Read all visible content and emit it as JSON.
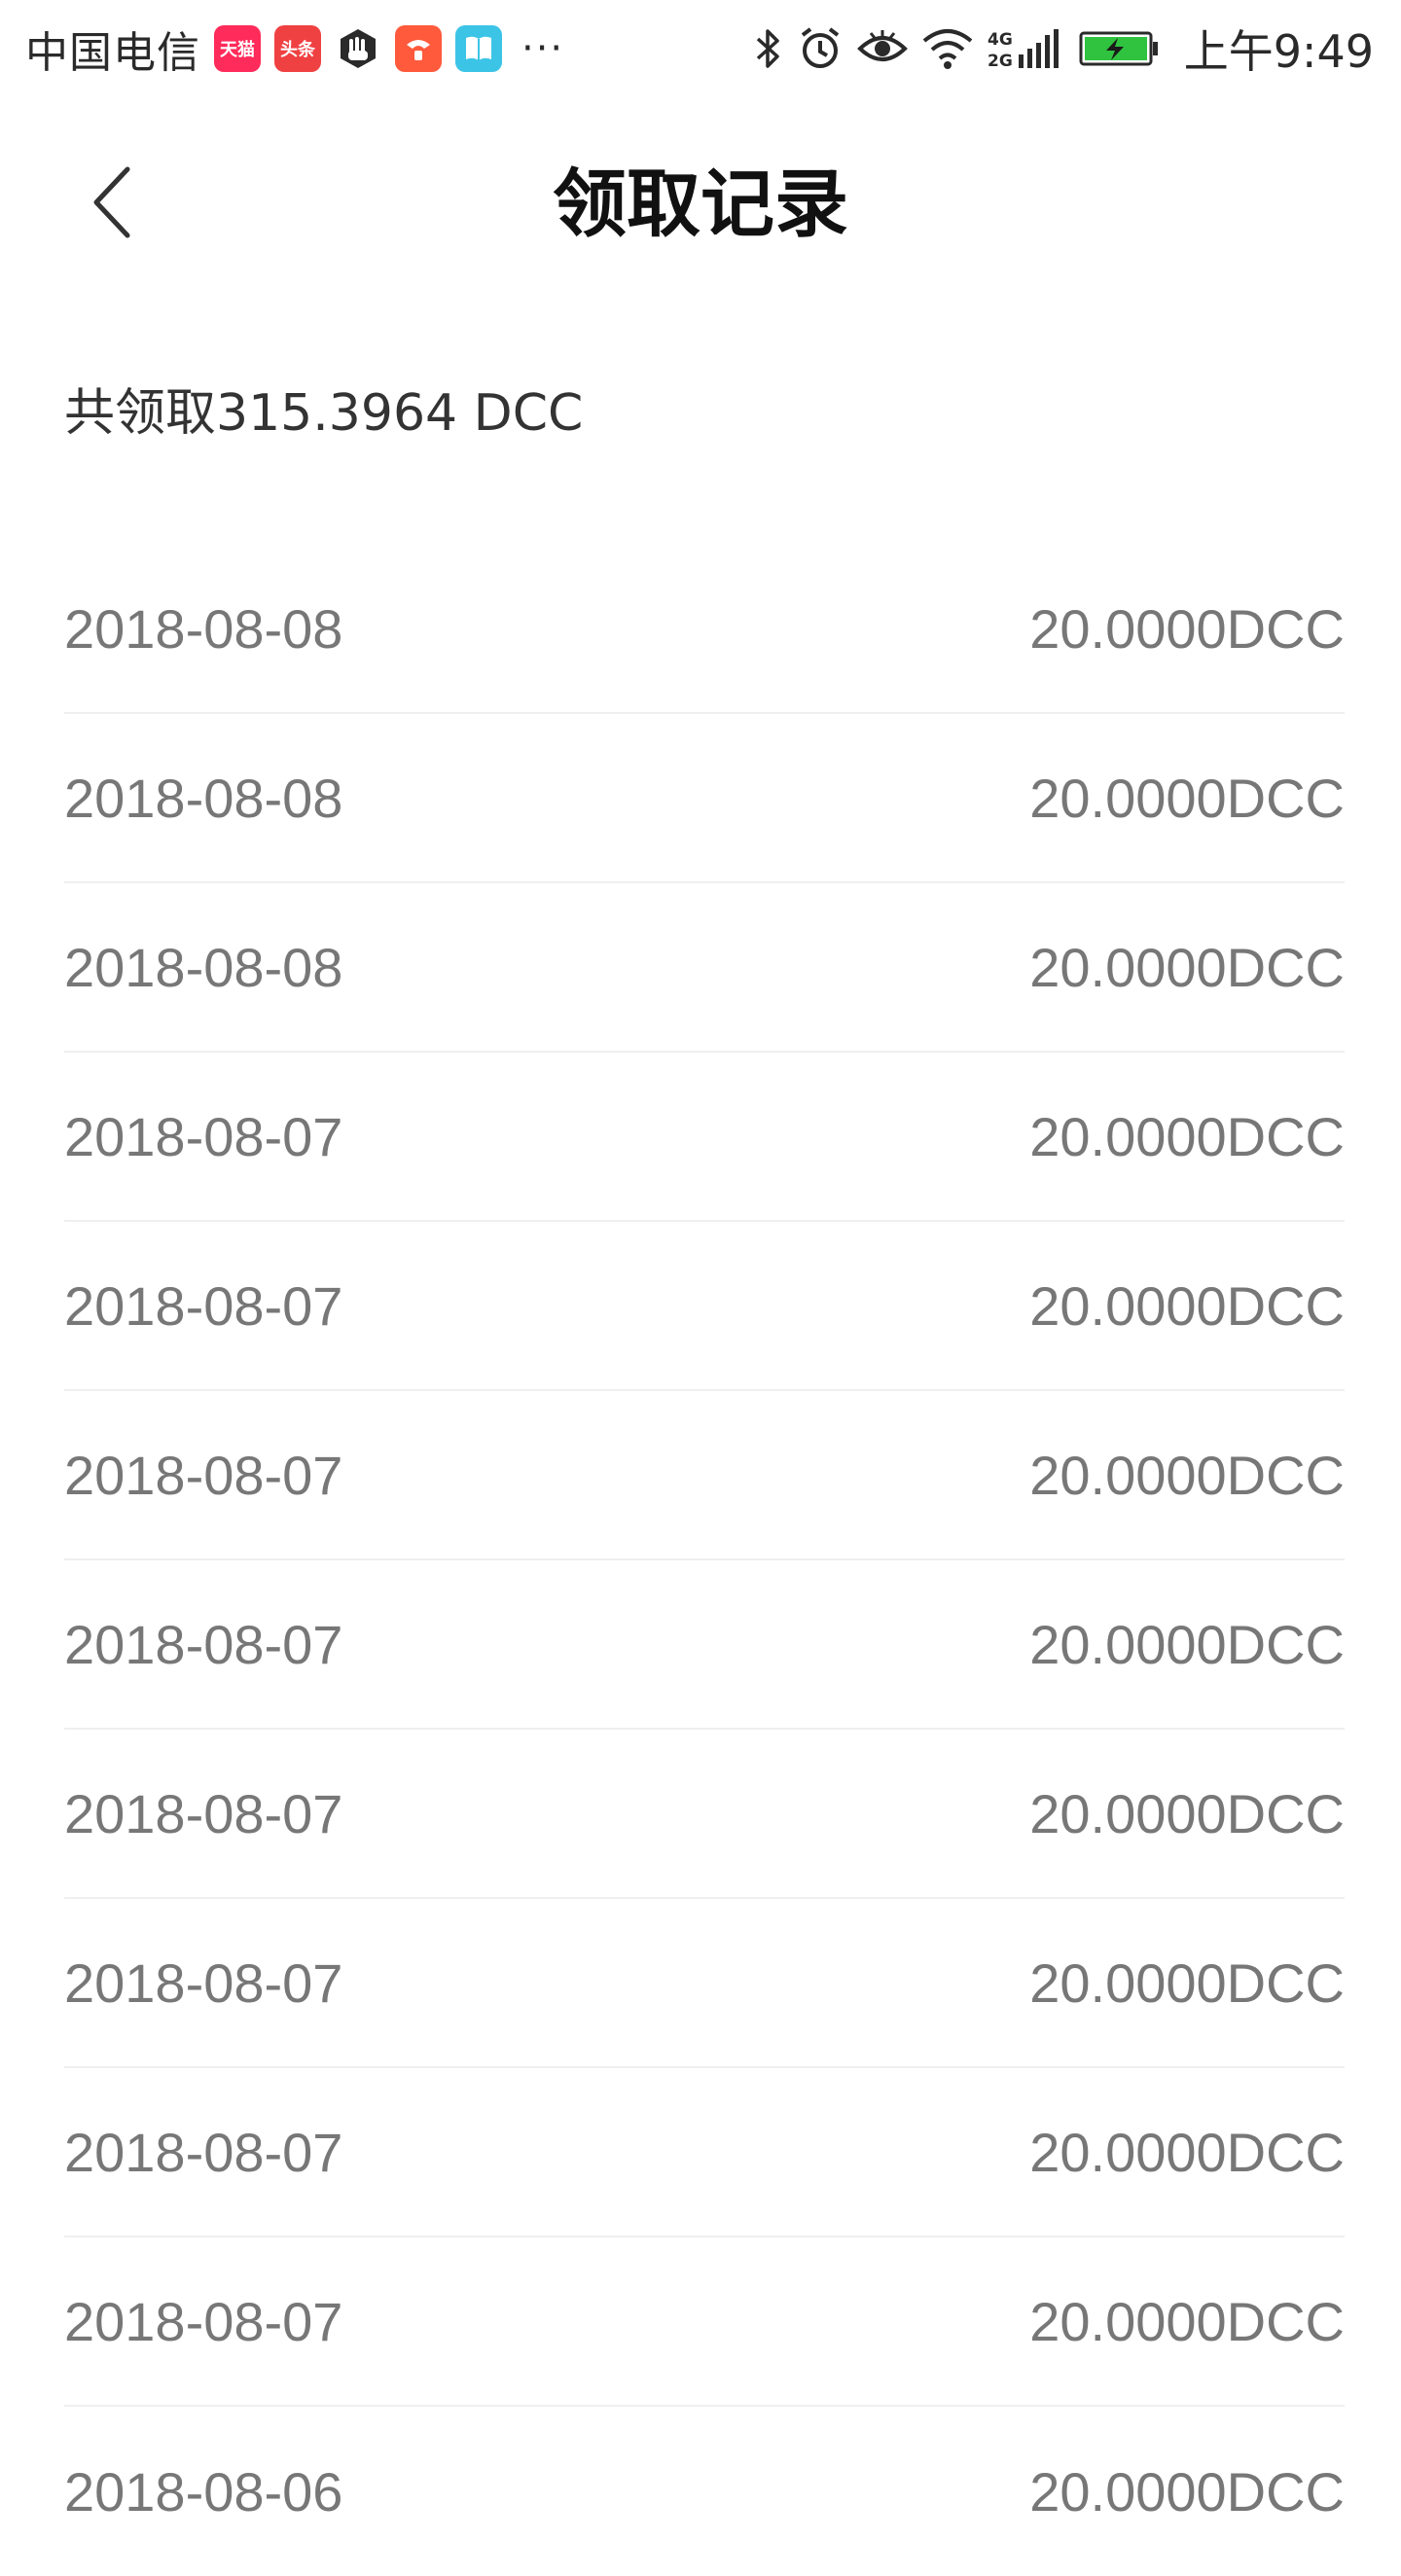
{
  "status_bar": {
    "carrier": "中国电信",
    "app_icons": [
      {
        "name": "tmall-icon",
        "label": "天猫"
      },
      {
        "name": "toutiao-icon",
        "label": "头条"
      },
      {
        "name": "hand-icon",
        "label": ""
      },
      {
        "name": "jd-icon",
        "label": ""
      },
      {
        "name": "book-icon",
        "label": ""
      }
    ],
    "more": "···",
    "network": "4G 2G",
    "time": "上午9:49"
  },
  "nav": {
    "title": "领取记录"
  },
  "summary": {
    "text": "共领取315.3964 DCC"
  },
  "records": [
    {
      "date": "2018-08-08",
      "amount": "20.0000DCC"
    },
    {
      "date": "2018-08-08",
      "amount": "20.0000DCC"
    },
    {
      "date": "2018-08-08",
      "amount": "20.0000DCC"
    },
    {
      "date": "2018-08-07",
      "amount": "20.0000DCC"
    },
    {
      "date": "2018-08-07",
      "amount": "20.0000DCC"
    },
    {
      "date": "2018-08-07",
      "amount": "20.0000DCC"
    },
    {
      "date": "2018-08-07",
      "amount": "20.0000DCC"
    },
    {
      "date": "2018-08-07",
      "amount": "20.0000DCC"
    },
    {
      "date": "2018-08-07",
      "amount": "20.0000DCC"
    },
    {
      "date": "2018-08-07",
      "amount": "20.0000DCC"
    },
    {
      "date": "2018-08-07",
      "amount": "20.0000DCC"
    },
    {
      "date": "2018-08-06",
      "amount": "20.0000DCC"
    }
  ]
}
